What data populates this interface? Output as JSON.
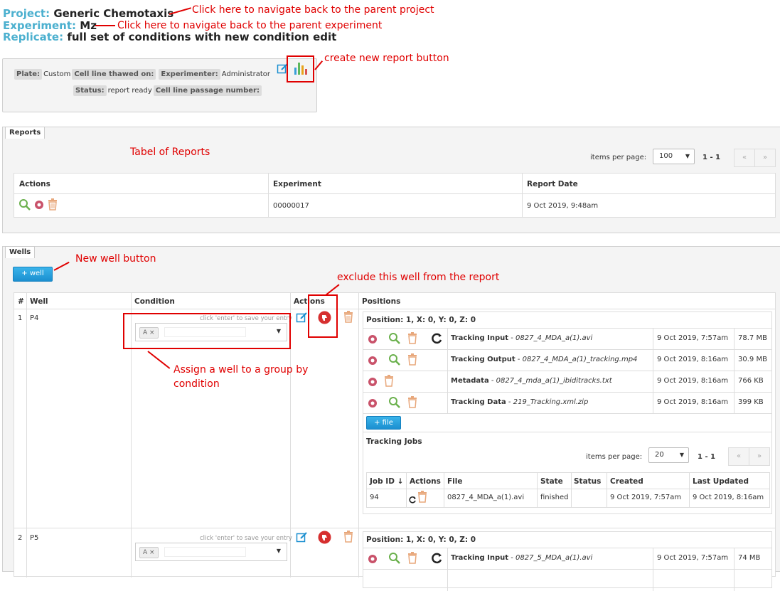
{
  "header": {
    "project_label": "Project:",
    "project_value": "Generic Chemotaxis",
    "experiment_label": "Experiment:",
    "experiment_value": "Mz",
    "replicate_label": "Replicate:",
    "replicate_value": "full set of conditions with new condition edit"
  },
  "annotations": {
    "project": "Click here to navigate back to the parent project",
    "experiment": "Click here to navigate back to the parent experiment",
    "report_button": "create new report button",
    "table_reports": "Tabel of Reports",
    "new_well": "New well button",
    "exclude_well": "exclude this well from the report",
    "assign_group": "Assign a well to a group by",
    "assign_group_2": "condition"
  },
  "info": {
    "plate_label": "Plate:",
    "plate_value": "Custom",
    "thawed_label": "Cell line thawed on:",
    "experimenter_label": "Experimenter:",
    "experimenter_value": "Administrator",
    "status_label": "Status:",
    "status_value": "report ready",
    "passage_label": "Cell line passage number:"
  },
  "reports": {
    "tab": "Reports",
    "items_per_page_label": "items per page:",
    "items_per_page_value": "100",
    "page_range": "1 - 1",
    "prev": "«",
    "next": "»",
    "columns": [
      "Actions",
      "Experiment",
      "Report Date"
    ],
    "rows": [
      {
        "experiment": "00000017",
        "date": "9 Oct 2019, 9:48am"
      }
    ]
  },
  "wells": {
    "tab": "Wells",
    "add_button": "+ well",
    "columns": [
      "#",
      "Well",
      "Condition",
      "Actions",
      "Positions"
    ],
    "hint": "click 'enter' to save your entry",
    "add_file": "+ file",
    "rows": [
      {
        "num": "1",
        "well": "P4",
        "condition_chip": "A ×",
        "position_title": "Position: 1, X: 0, Y: 0, Z: 0",
        "files": [
          {
            "kind": "Tracking Input",
            "name": "0827_4_MDA_a(1).avi",
            "date": "9 Oct 2019, 7:57am",
            "size": "78.7 MB"
          },
          {
            "kind": "Tracking Output",
            "name": "0827_4_MDA_a(1)_tracking.mp4",
            "date": "9 Oct 2019, 8:16am",
            "size": "30.9 MB"
          },
          {
            "kind": "Metadata",
            "name": "0827_4_mda_a(1)_ibiditracks.txt",
            "date": "9 Oct 2019, 8:16am",
            "size": "766 KB"
          },
          {
            "kind": "Tracking Data",
            "name": "219_Tracking.xml.zip",
            "date": "9 Oct 2019, 8:16am",
            "size": "399 KB"
          }
        ],
        "jobs": {
          "title": "Tracking Jobs",
          "items_per_page_label": "items per page:",
          "items_per_page_value": "20",
          "page_range": "1 - 1",
          "columns": [
            "Job ID ↓",
            "Actions",
            "File",
            "State",
            "Status",
            "Created",
            "Last Updated"
          ],
          "rows": [
            {
              "id": "94",
              "file": "0827_4_MDA_a(1).avi",
              "state": "finished",
              "status": "",
              "created": "9 Oct 2019, 7:57am",
              "updated": "9 Oct 2019, 8:16am"
            }
          ]
        }
      },
      {
        "num": "2",
        "well": "P5",
        "condition_chip": "A ×",
        "position_title": "Position: 1, X: 0, Y: 0, Z: 0",
        "files": [
          {
            "kind": "Tracking Input",
            "name": "0827_5_MDA_a(1).avi",
            "date": "9 Oct 2019, 7:57am",
            "size": "74 MB"
          }
        ]
      }
    ]
  },
  "colors": {
    "accent": "#4cb0cf",
    "annotation": "#e00000",
    "button": "#1b8fd0"
  }
}
